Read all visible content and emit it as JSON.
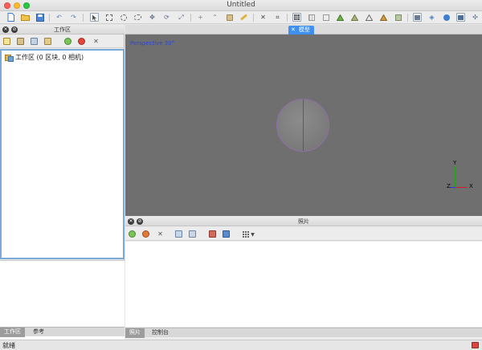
{
  "window": {
    "title": "Untitled"
  },
  "toolbar": {
    "icons": [
      "new-file-icon",
      "open-folder-icon",
      "save-icon",
      "undo-icon",
      "redo-icon",
      "pointer-icon",
      "rect-select-icon",
      "circle-select-icon",
      "lasso-select-icon",
      "move-icon",
      "rotate-icon",
      "scale-icon",
      "crosshair-icon",
      "ruler-icon",
      "paint-icon",
      "measure-icon",
      "cut-icon",
      "crop-icon",
      "grid-icon",
      "grid-dots-icon",
      "ortho-icon",
      "shade-icon",
      "texture-icon",
      "mesh-icon",
      "points-icon",
      "wire-icon",
      "photo-icon",
      "shapes-icon",
      "panel-icon",
      "move-arrows-icon"
    ]
  },
  "workspace": {
    "title": "工作区",
    "tree_root": "工作区 (0 区块, 0 相机)",
    "tabs": [
      "工作区",
      "参考"
    ],
    "active_tab": 0
  },
  "model_tab": {
    "label": "模型",
    "close": "✕"
  },
  "viewport": {
    "projection_label": "Perspective 30°",
    "axis_labels": {
      "y": "Y",
      "z": "Z",
      "x": "X"
    },
    "colors": {
      "x": "#d02020",
      "y": "#1ea51e",
      "z": "#1f3fd0",
      "label": "#2a46d8"
    }
  },
  "photos": {
    "title": "照片",
    "tabs": [
      "照片",
      "控制台"
    ],
    "active_tab": 0
  },
  "status": {
    "text": "就绪"
  },
  "panel_buttons": {
    "close": "✕",
    "float": "⊘"
  }
}
